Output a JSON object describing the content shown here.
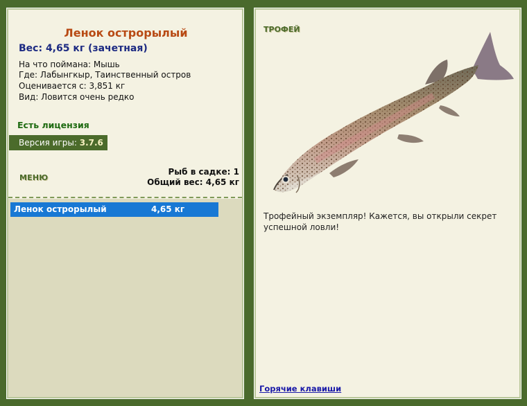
{
  "fish": {
    "name": "Ленок острорылый",
    "weight_line": "Вес: 4,65 кг (зачетная)",
    "info": [
      "На что поймана: Мышь",
      "Где: Лабынгкыр, Таинственный остров",
      "Оценивается с: 3,851 кг",
      "Вид: Ловится очень редко"
    ]
  },
  "license": "Есть лицензия",
  "version": {
    "label": "Версия игры:",
    "value": "3.7.6"
  },
  "menu_label": "МЕНЮ",
  "keep": {
    "count_line": "Рыб в садке: 1",
    "total_line": "Общий вес: 4,65 кг",
    "items": [
      {
        "name": "Ленок острорылый",
        "weight": "4,65 кг"
      }
    ]
  },
  "trophy": {
    "label": "ТРОФЕЙ",
    "text": "Трофейный экземпляр! Кажется, вы открыли секрет успешной ловли!",
    "image_icon": "fish-lenok-image"
  },
  "hotkeys_link": "Горячие клавиши",
  "colors": {
    "background": "#4a6a2c",
    "panel": "#f4f2e2",
    "selection": "#1878d4",
    "title": "#b84a14",
    "weight": "#1c2a82",
    "license": "#1f6b12"
  }
}
